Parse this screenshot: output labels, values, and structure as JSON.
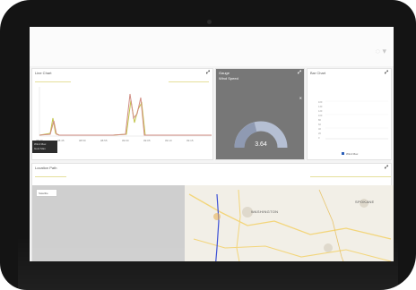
{
  "cards": {
    "line_chart": {
      "title": "Line Chart",
      "menu_icon": "expand-icon",
      "x_ticks": [
        "08:30",
        "08:45",
        "08:50",
        "08:55",
        "09:00",
        "09:05",
        "09:10",
        "09:15"
      ]
    },
    "gauge": {
      "title": "Gauge",
      "subtitle": "Wind Speed",
      "value": "3.64"
    },
    "bar_chart": {
      "title": "Bar Chart",
      "y_ticks": [
        "100",
        "140",
        "120",
        "100",
        "80",
        "60",
        "40",
        "20",
        "0"
      ],
      "legend": "Wind Max"
    },
    "location": {
      "title": "Location Path",
      "button_label": "Satellite"
    }
  },
  "tooltip": {
    "line1": "Wind Max",
    "line2": "Gust Max"
  },
  "map": {
    "cities": [
      "WASHINGTON",
      "SPOKANE"
    ]
  },
  "colors": {
    "line_series_1": "#d08c82",
    "line_series_2": "#c2c44a",
    "route": "#3b4fd6",
    "gauge_arc": "#b5bfd3"
  }
}
